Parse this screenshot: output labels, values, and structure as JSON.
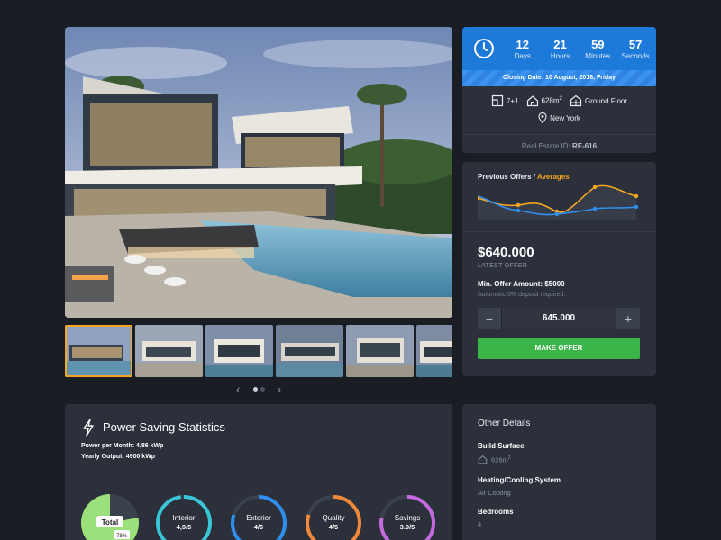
{
  "gallery": {
    "thumbnail_count": 6,
    "active_thumbnail": 0,
    "pager": {
      "prev_icon": "chevron-left-icon",
      "next_icon": "chevron-right-icon",
      "dots": 2,
      "active_dot": 0
    }
  },
  "countdown": {
    "units": [
      {
        "value": "12",
        "label": "Days"
      },
      {
        "value": "21",
        "label": "Hours"
      },
      {
        "value": "59",
        "label": "Minutes"
      },
      {
        "value": "57",
        "label": "Seconds"
      }
    ],
    "closing_date": "Closing Date: 10 August, 2018, Friday",
    "accent_color": "#1e7ad8"
  },
  "features": {
    "rooms": "7+1",
    "area": "628m",
    "area_sup": "2",
    "floor": "Ground Floor",
    "location": "New York",
    "real_estate_id_label": "Real Estate ID:",
    "real_estate_id": "RE-616"
  },
  "offers": {
    "heading_prefix": "Previous Offers /",
    "heading_avg": "Averages",
    "price": "$640.000",
    "latest_label": "LATEST OFFER",
    "min_offer": "Min. Offer Amount: $5000",
    "deposit_note": "Automatic 5% deposit required.",
    "stepper_value": "645.000",
    "minus_label": "−",
    "plus_label": "+",
    "make_offer_label": "MAKE OFFER",
    "button_color": "#3bb44a",
    "chart_colors": {
      "offers": "#2f8ff0",
      "averages": "#f5a623"
    }
  },
  "power": {
    "title": "Power Saving Statistics",
    "per_month": "Power per Month: 4,86 kWp",
    "yearly": "Yearly Output: 4900 kWp",
    "gauges": [
      {
        "label": "Total",
        "value": "78%",
        "fraction": 0.78,
        "color": "#9be07a"
      },
      {
        "label": "Interior",
        "value": "4,9/5",
        "fraction": 0.98,
        "color": "#39c6d6"
      },
      {
        "label": "Exterior",
        "value": "4/5",
        "fraction": 0.8,
        "color": "#2f8ff0"
      },
      {
        "label": "Quality",
        "value": "4/5",
        "fraction": 0.8,
        "color": "#f2883a"
      },
      {
        "label": "Savings",
        "value": "3.9/5",
        "fraction": 0.78,
        "color": "#c46adf"
      }
    ]
  },
  "other": {
    "title": "Other Details",
    "build_surface_label": "Build Surface",
    "build_surface_value": "628m",
    "build_surface_sup": "2",
    "heating_label": "Heating/Cooling System",
    "heating_value": "Air Cooling",
    "bedrooms_label": "Bedrooms",
    "bedrooms_value": "4"
  }
}
